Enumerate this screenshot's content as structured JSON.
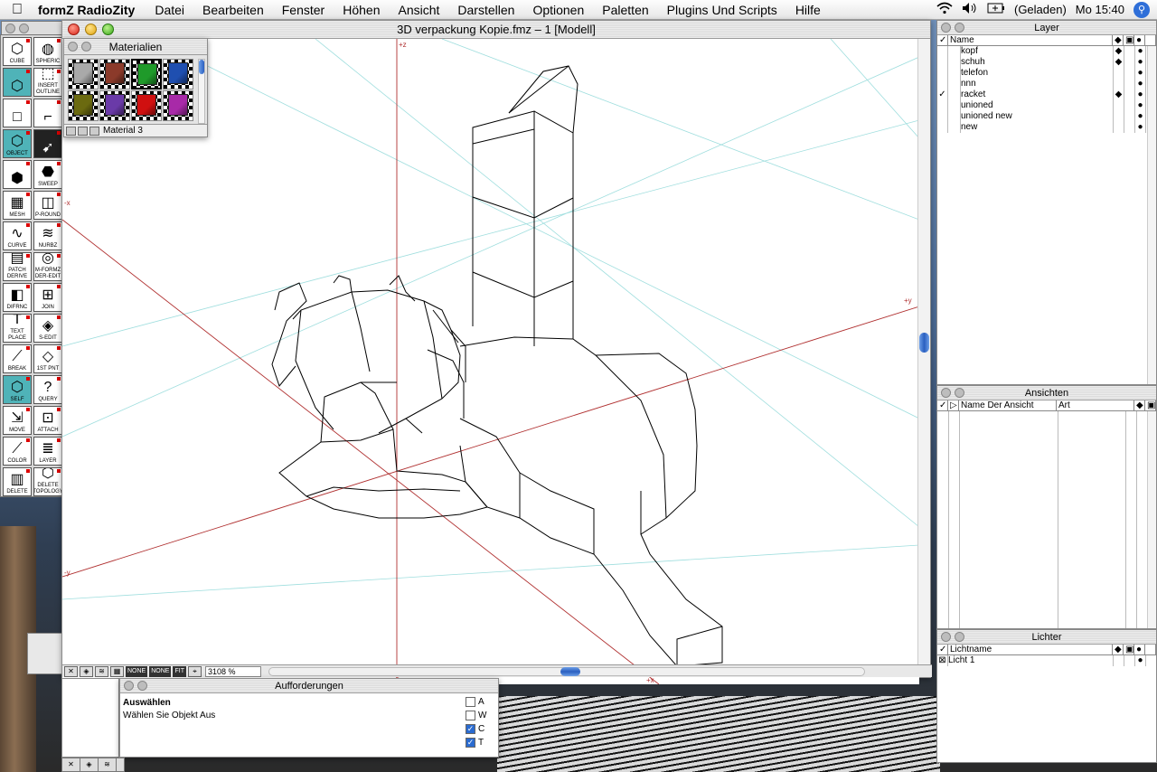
{
  "menubar": {
    "app_name": "formZ RadioZity",
    "items": [
      "Datei",
      "Bearbeiten",
      "Fenster",
      "Höhen",
      "Ansicht",
      "Darstellen",
      "Optionen",
      "Paletten",
      "Plugins Und Scripts",
      "Hilfe"
    ],
    "battery_status": "(Geladen)",
    "clock": "Mo 15:40"
  },
  "main_window": {
    "title": "3D verpackung Kopie.fmz – 1 [Modell]",
    "axis_labels": {
      "plus_z": "+z",
      "minus_z": "-z",
      "plus_y": "+y",
      "minus_y": "-y",
      "plus_x": "+x",
      "minus_x": "-x"
    },
    "status": {
      "none1": "NONE",
      "none2": "NONE",
      "fit": "FIT",
      "zoom": "3108 %"
    }
  },
  "toolbox": {
    "tools": [
      {
        "label": "CUBE",
        "icon": "cube-icon"
      },
      {
        "label": "SPHERIC",
        "icon": "sphere-icon"
      },
      {
        "label": "",
        "icon": "cube-teal-icon"
      },
      {
        "label": "INSERT OUTLINE",
        "icon": "insert-outline-icon"
      },
      {
        "label": "",
        "icon": "square-icon"
      },
      {
        "label": "",
        "icon": "extrude-icon"
      },
      {
        "label": "OBJECT",
        "icon": "object-icon"
      },
      {
        "label": "",
        "icon": "pointer-icon"
      },
      {
        "label": "",
        "icon": "cube-wire-icon"
      },
      {
        "label": "SWEEP",
        "icon": "sweep-icon"
      },
      {
        "label": "MESH",
        "icon": "mesh-icon"
      },
      {
        "label": "P-ROUND",
        "icon": "round-icon"
      },
      {
        "label": "CURVE",
        "icon": "curve-icon"
      },
      {
        "label": "NURBZ",
        "icon": "nurbz-icon"
      },
      {
        "label": "PATCH DERIVE",
        "icon": "patch-icon"
      },
      {
        "label": "M-FORMZ DER-EDIT",
        "icon": "mformz-icon"
      },
      {
        "label": "DIFRNC",
        "icon": "difference-icon"
      },
      {
        "label": "JOIN",
        "icon": "join-icon"
      },
      {
        "label": "TEXT PLACE",
        "icon": "text-icon"
      },
      {
        "label": "S-EDIT",
        "icon": "sedit-icon"
      },
      {
        "label": "BREAK",
        "icon": "break-icon"
      },
      {
        "label": "1ST PNT",
        "icon": "first-point-icon"
      },
      {
        "label": "SELF",
        "icon": "self-icon"
      },
      {
        "label": "QUERY",
        "icon": "query-icon"
      },
      {
        "label": "MOVE",
        "icon": "move-icon"
      },
      {
        "label": "ATTACH",
        "icon": "attach-icon"
      },
      {
        "label": "COLOR",
        "icon": "color-icon"
      },
      {
        "label": "LAYER",
        "icon": "layer-icon"
      },
      {
        "label": "DELETE",
        "icon": "delete-icon"
      },
      {
        "label": "DELETE TOPOLOGY",
        "icon": "delete-topology-icon"
      }
    ]
  },
  "materials": {
    "title": "Materialien",
    "swatches": [
      "#a9a9a9",
      "#8b3a2a",
      "#1f9a2a",
      "#1f4fb0",
      "#6b6a10",
      "#6a3aa8",
      "#d01010",
      "#a82aa8"
    ],
    "selected_name": "Material 3"
  },
  "layer_palette": {
    "title": "Layer",
    "header": "Name",
    "layers": [
      {
        "name": "kopf",
        "check": "",
        "diamond": "◆"
      },
      {
        "name": "schuh",
        "check": "",
        "diamond": "◆"
      },
      {
        "name": "telefon",
        "check": "",
        "diamond": ""
      },
      {
        "name": "nnn",
        "check": "",
        "diamond": ""
      },
      {
        "name": "racket",
        "check": "✓",
        "diamond": "◆"
      },
      {
        "name": "unioned",
        "check": "",
        "diamond": ""
      },
      {
        "name": "unioned new",
        "check": "",
        "diamond": ""
      },
      {
        "name": "new",
        "check": "",
        "diamond": ""
      }
    ]
  },
  "views_palette": {
    "title": "Ansichten",
    "header_name": "Name Der Ansicht",
    "header_type": "Art"
  },
  "lights_palette": {
    "title": "Lichter",
    "header": "Lichtname",
    "lights": [
      {
        "name": "Licht 1"
      }
    ]
  },
  "prompts": {
    "title": "Aufforderungen",
    "heading": "Auswählen",
    "message": "Wählen Sie Objekt Aus",
    "options": [
      {
        "label": "A",
        "checked": false
      },
      {
        "label": "W",
        "checked": false
      },
      {
        "label": "C",
        "checked": true
      },
      {
        "label": "T",
        "checked": true
      }
    ]
  }
}
